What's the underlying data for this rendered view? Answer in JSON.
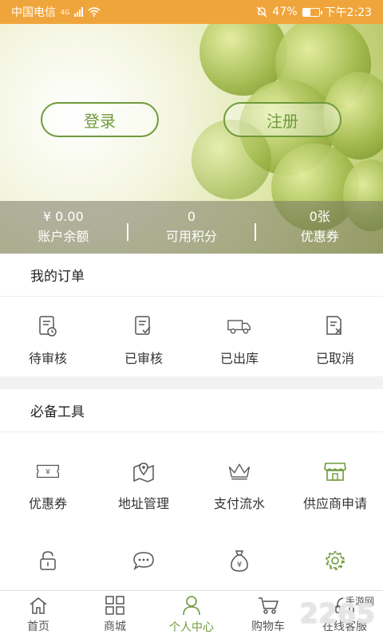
{
  "status": {
    "carrier": "中国电信",
    "network": "4G",
    "battery": "47%",
    "time": "下午2:23"
  },
  "auth": {
    "login": "登录",
    "register": "注册"
  },
  "account": [
    {
      "value": "¥ 0.00",
      "label": "账户余额"
    },
    {
      "value": "0",
      "label": "可用积分"
    },
    {
      "value": "0张",
      "label": "优惠券"
    }
  ],
  "orders": {
    "title": "我的订单",
    "items": [
      {
        "label": "待审核",
        "icon": "pending-review-icon"
      },
      {
        "label": "已审核",
        "icon": "reviewed-icon"
      },
      {
        "label": "已出库",
        "icon": "shipped-truck-icon"
      },
      {
        "label": "已取消",
        "icon": "cancelled-icon"
      }
    ]
  },
  "tools": {
    "title": "必备工具",
    "items": [
      {
        "label": "优惠券",
        "icon": "coupon-icon"
      },
      {
        "label": "地址管理",
        "icon": "map-pin-icon"
      },
      {
        "label": "支付流水",
        "icon": "crown-icon"
      },
      {
        "label": "供应商申请",
        "icon": "store-icon"
      }
    ],
    "row2_icons": [
      "lock-icon",
      "chat-icon",
      "money-bag-icon",
      "gear-icon"
    ]
  },
  "tabs": [
    {
      "label": "首页",
      "icon": "home-icon"
    },
    {
      "label": "商城",
      "icon": "grid-icon"
    },
    {
      "label": "个人中心",
      "icon": "person-icon"
    },
    {
      "label": "购物车",
      "icon": "cart-icon"
    },
    {
      "label": "在线客服",
      "icon": "headset-icon"
    }
  ],
  "watermark": {
    "text": "2265",
    "sub": "手游网"
  },
  "colors": {
    "status": "#f0a53c",
    "accent": "#6f9a3b"
  }
}
